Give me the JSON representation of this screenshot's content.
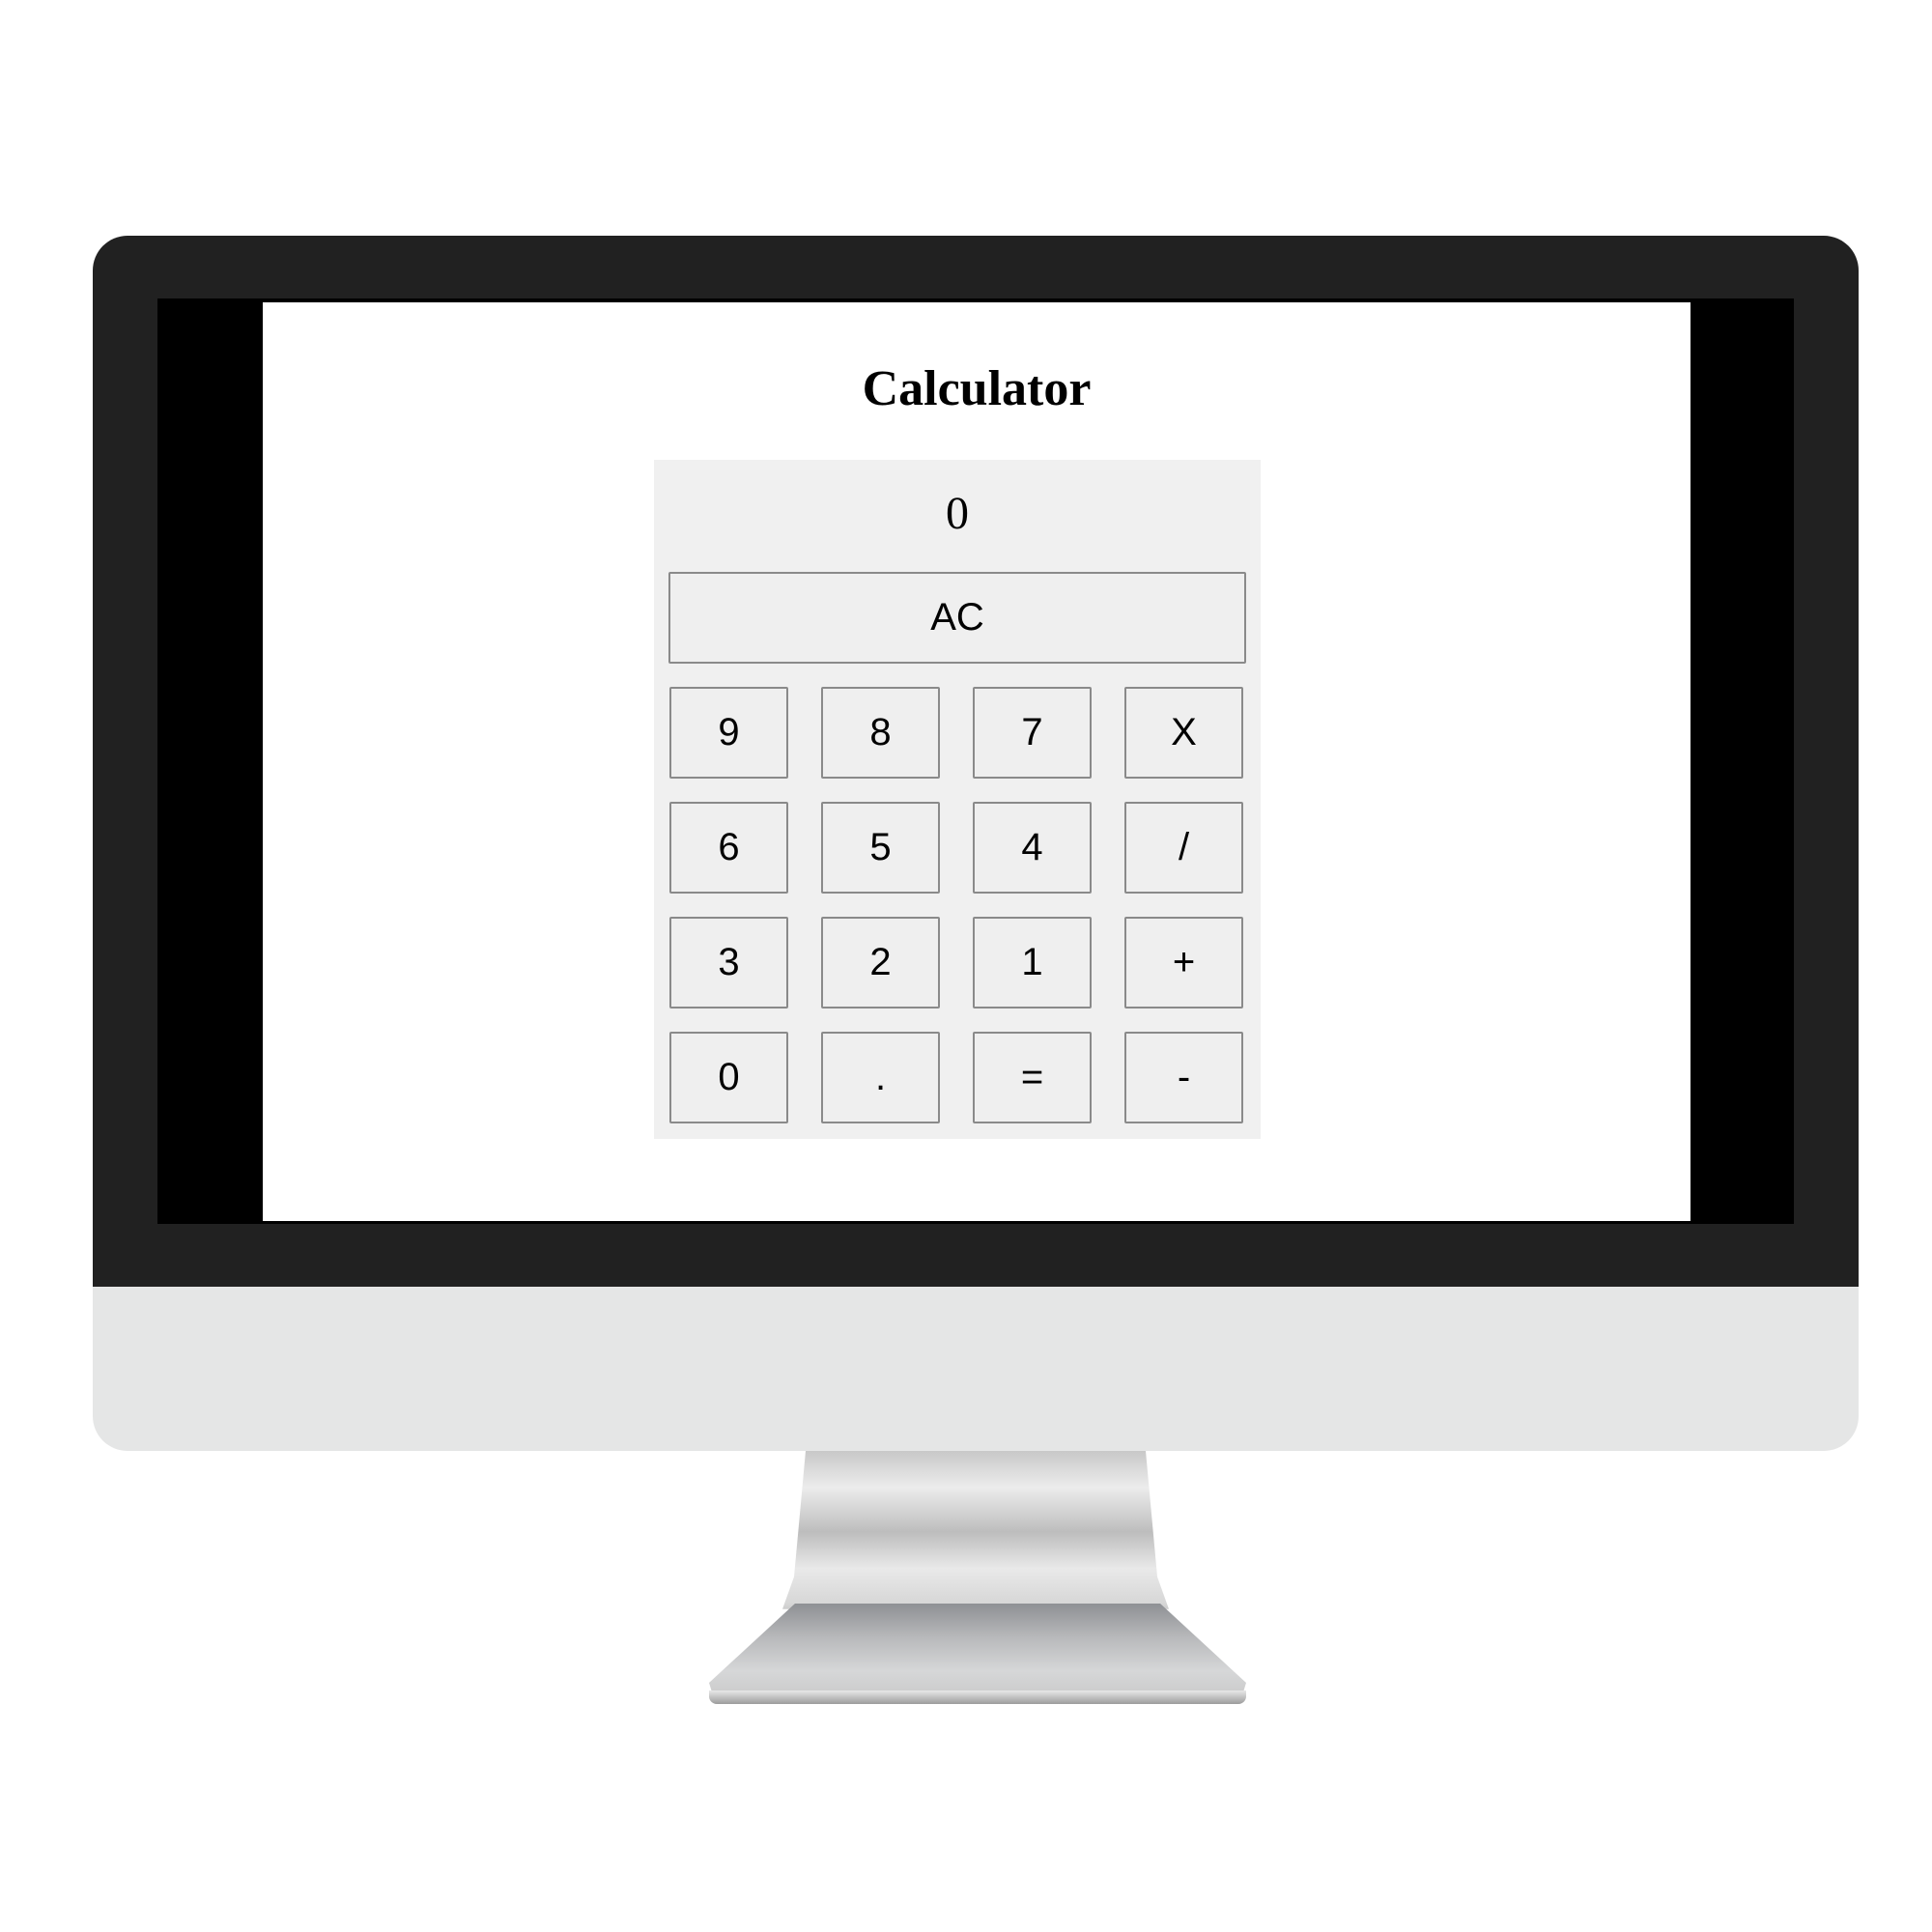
{
  "page": {
    "title": "Calculator"
  },
  "calculator": {
    "display_value": "0",
    "clear_label": "AC",
    "keys": [
      [
        "9",
        "8",
        "7",
        "X"
      ],
      [
        "6",
        "5",
        "4",
        "/"
      ],
      [
        "3",
        "2",
        "1",
        "+"
      ],
      [
        "0",
        ".",
        "=",
        "-"
      ]
    ]
  }
}
